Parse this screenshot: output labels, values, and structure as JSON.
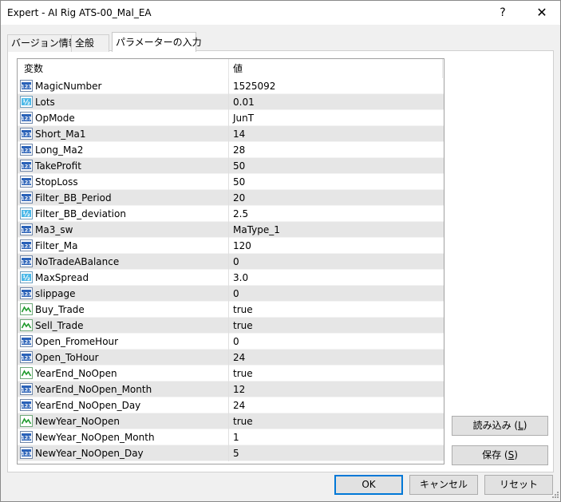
{
  "window": {
    "title": "Expert - AI Rig ATS-00_Mal_EA",
    "help_label": "?",
    "close_label": "✕"
  },
  "tabs": [
    {
      "label": "バージョン情報",
      "active": false
    },
    {
      "label": "全般",
      "active": false
    },
    {
      "label": "パラメーターの入力",
      "active": true
    }
  ],
  "grid": {
    "columns": {
      "name": "変数",
      "value": "値"
    },
    "rows": [
      {
        "icon": "int-icon",
        "name": "MagicNumber",
        "value": "1525092"
      },
      {
        "icon": "float-icon",
        "name": "Lots",
        "value": "0.01"
      },
      {
        "icon": "int-icon",
        "name": "OpMode",
        "value": "JunT"
      },
      {
        "icon": "int-icon",
        "name": "Short_Ma1",
        "value": "14"
      },
      {
        "icon": "int-icon",
        "name": "Long_Ma2",
        "value": "28"
      },
      {
        "icon": "int-icon",
        "name": "TakeProfit",
        "value": "50"
      },
      {
        "icon": "int-icon",
        "name": "StopLoss",
        "value": "50"
      },
      {
        "icon": "int-icon",
        "name": "Filter_BB_Period",
        "value": "20"
      },
      {
        "icon": "float-icon",
        "name": "Filter_BB_deviation",
        "value": "2.5"
      },
      {
        "icon": "int-icon",
        "name": "Ma3_sw",
        "value": "MaType_1"
      },
      {
        "icon": "int-icon",
        "name": "Filter_Ma",
        "value": "120"
      },
      {
        "icon": "int-icon",
        "name": "NoTradeABalance",
        "value": "0"
      },
      {
        "icon": "float-icon",
        "name": "MaxSpread",
        "value": "3.0"
      },
      {
        "icon": "int-icon",
        "name": "slippage",
        "value": "0"
      },
      {
        "icon": "bool-icon",
        "name": "Buy_Trade",
        "value": "true"
      },
      {
        "icon": "bool-icon",
        "name": "Sell_Trade",
        "value": "true"
      },
      {
        "icon": "int-icon",
        "name": "Open_FromeHour",
        "value": "0"
      },
      {
        "icon": "int-icon",
        "name": "Open_ToHour",
        "value": "24"
      },
      {
        "icon": "bool-icon",
        "name": "YearEnd_NoOpen",
        "value": "true"
      },
      {
        "icon": "int-icon",
        "name": "YearEnd_NoOpen_Month",
        "value": "12"
      },
      {
        "icon": "int-icon",
        "name": "YearEnd_NoOpen_Day",
        "value": "24"
      },
      {
        "icon": "bool-icon",
        "name": "NewYear_NoOpen",
        "value": "true"
      },
      {
        "icon": "int-icon",
        "name": "NewYear_NoOpen_Month",
        "value": "1"
      },
      {
        "icon": "int-icon",
        "name": "NewYear_NoOpen_Day",
        "value": "5"
      }
    ]
  },
  "side_buttons": {
    "load_label": "読み込み (",
    "load_key": "L",
    "load_end": ")",
    "save_label": "保存 (",
    "save_key": "S",
    "save_end": ")"
  },
  "footer_buttons": {
    "ok": "OK",
    "cancel": "キャンセル",
    "reset": "リセット"
  },
  "icon_text": {
    "int": "123",
    "float": "½"
  },
  "colors": {
    "accent": "#0078d7",
    "int_icon_bg": "#2a62b8",
    "float_icon_bg": "#4bb8e8",
    "bool_icon_line": "#1e9a2c"
  }
}
